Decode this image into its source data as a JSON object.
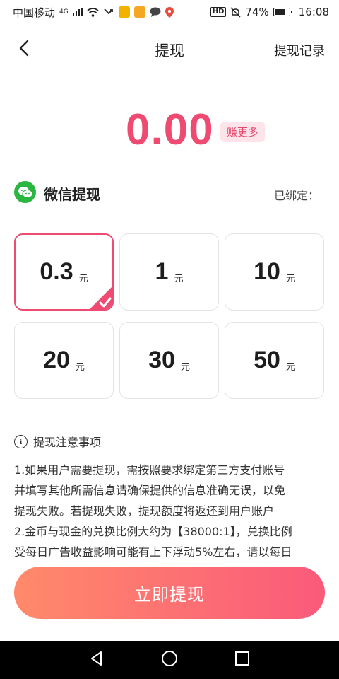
{
  "status_bar": {
    "carrier": "中国移动",
    "network": "4G",
    "battery": "74%",
    "battery_level": 0.74,
    "time": "16:08",
    "hd": "HD"
  },
  "header": {
    "title": "提现",
    "records_label": "提现记录",
    "back_icon": "chevron-left-icon"
  },
  "balance": {
    "amount": "0.00",
    "earn_more_label": "赚更多",
    "color": "#ef4a72"
  },
  "method": {
    "label": "微信提现",
    "bound_label": "已绑定：",
    "icon": "wechat-icon",
    "icon_color": "#2bb541"
  },
  "options": [
    {
      "value": "0.3",
      "unit": "元",
      "selected": true
    },
    {
      "value": "1",
      "unit": "元",
      "selected": false
    },
    {
      "value": "10",
      "unit": "元",
      "selected": false
    },
    {
      "value": "20",
      "unit": "元",
      "selected": false
    },
    {
      "value": "30",
      "unit": "元",
      "selected": false
    },
    {
      "value": "50",
      "unit": "元",
      "selected": false
    }
  ],
  "notes": {
    "title": "提现注意事项",
    "lines": [
      "1.如果用户需要提现，需按照要求绑定第三方支付账号",
      "并填写其他所需信息请确保提供的信息准确无误，以免",
      "提现失败。若提现失败，提现额度将返还到用户账户",
      " 2.金币与现金的兑换比例大约为【38000:1】，兑换比例",
      "受每日广告收益影响可能有上下浮动5%左右，请以每日"
    ]
  },
  "submit_label": "立即提现",
  "accent_color": "#ef4a72"
}
